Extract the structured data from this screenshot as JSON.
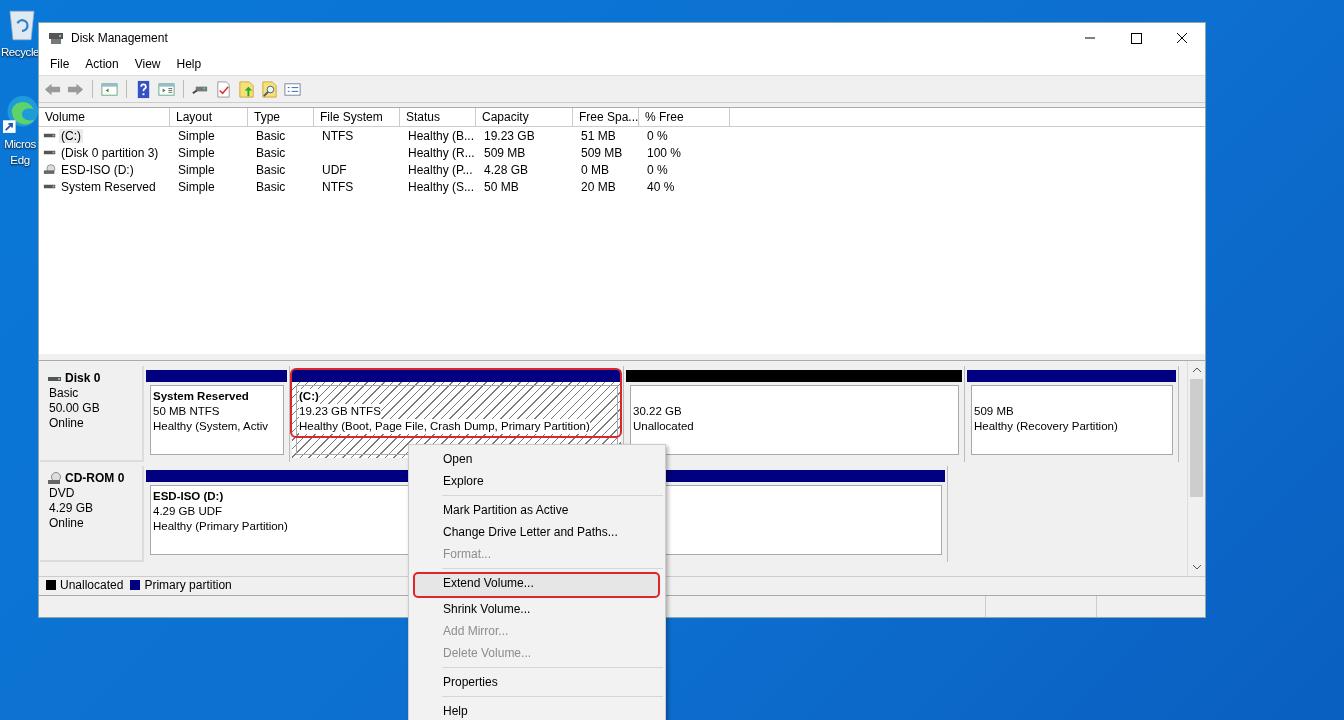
{
  "desktop_icons": [
    {
      "kind": "recycle-bin",
      "label_lines": [
        "Recycle"
      ]
    },
    {
      "kind": "browser",
      "label_lines": [
        "Micros",
        "Edg"
      ]
    }
  ],
  "window": {
    "title": "Disk Management"
  },
  "menu": [
    "File",
    "Action",
    "View",
    "Help"
  ],
  "volume_list": {
    "columns": [
      "Volume",
      "Layout",
      "Type",
      "File System",
      "Status",
      "Capacity",
      "Free Spa...",
      "% Free"
    ],
    "rows": [
      {
        "kind": "hdd",
        "selected": true,
        "cells": [
          "(C:)",
          "Simple",
          "Basic",
          "NTFS",
          "Healthy (B...",
          "19.23 GB",
          "51 MB",
          "0 %"
        ]
      },
      {
        "kind": "hdd",
        "selected": false,
        "cells": [
          "(Disk 0 partition 3)",
          "Simple",
          "Basic",
          "",
          "Healthy (R...",
          "509 MB",
          "509 MB",
          "100 %"
        ]
      },
      {
        "kind": "cd",
        "selected": false,
        "cells": [
          "ESD-ISO (D:)",
          "Simple",
          "Basic",
          "UDF",
          "Healthy (P...",
          "4.28 GB",
          "0 MB",
          "0 %"
        ]
      },
      {
        "kind": "hdd",
        "selected": false,
        "cells": [
          "System Reserved",
          "Simple",
          "Basic",
          "NTFS",
          "Healthy (S...",
          "50 MB",
          "20 MB",
          "40 %"
        ]
      }
    ]
  },
  "disks": [
    {
      "kind": "hdd",
      "name": "Disk 0",
      "type": "Basic",
      "size": "50.00 GB",
      "status": "Online",
      "partitions": [
        {
          "kind": "primary",
          "selected": false,
          "highlighted": false,
          "title": "System Reserved",
          "size": "50 MB NTFS",
          "status": "Healthy (System, Activ"
        },
        {
          "kind": "primary",
          "selected": true,
          "highlighted": true,
          "title": "(C:)",
          "size": "19.23 GB NTFS",
          "status": "Healthy (Boot, Page File, Crash Dump, Primary Partition)"
        },
        {
          "kind": "unallocated",
          "selected": false,
          "highlighted": false,
          "size": "30.22 GB",
          "status": "Unallocated"
        },
        {
          "kind": "primary",
          "selected": false,
          "highlighted": false,
          "size": "509 MB",
          "status": "Healthy (Recovery Partition)"
        }
      ]
    },
    {
      "kind": "cd",
      "name": "CD-ROM 0",
      "type": "DVD",
      "size": "4.29 GB",
      "status": "Online",
      "partitions": [
        {
          "kind": "primary",
          "selected": false,
          "highlighted": false,
          "title": "ESD-ISO  (D:)",
          "size": "4.29 GB UDF",
          "status": "Healthy (Primary Partition)"
        }
      ]
    }
  ],
  "legend": [
    {
      "label": "Unallocated",
      "color": "#000000"
    },
    {
      "label": "Primary partition",
      "color": "#000080"
    }
  ],
  "context_menu": [
    {
      "kind": "item",
      "label": "Open",
      "disabled": false,
      "highlighted": false
    },
    {
      "kind": "item",
      "label": "Explore",
      "disabled": false,
      "highlighted": false
    },
    {
      "kind": "separator"
    },
    {
      "kind": "item",
      "label": "Mark Partition as Active",
      "disabled": false,
      "highlighted": false
    },
    {
      "kind": "item",
      "label": "Change Drive Letter and Paths...",
      "disabled": false,
      "highlighted": false
    },
    {
      "kind": "item",
      "label": "Format...",
      "disabled": true,
      "highlighted": false
    },
    {
      "kind": "separator"
    },
    {
      "kind": "item",
      "label": "Extend Volume...",
      "disabled": false,
      "highlighted": true
    },
    {
      "kind": "item",
      "label": "Shrink Volume...",
      "disabled": false,
      "highlighted": false
    },
    {
      "kind": "item",
      "label": "Add Mirror...",
      "disabled": true,
      "highlighted": false
    },
    {
      "kind": "item",
      "label": "Delete Volume...",
      "disabled": true,
      "highlighted": false
    },
    {
      "kind": "separator"
    },
    {
      "kind": "item",
      "label": "Properties",
      "disabled": false,
      "highlighted": false
    },
    {
      "kind": "separator"
    },
    {
      "kind": "item",
      "label": "Help",
      "disabled": false,
      "highlighted": false
    }
  ]
}
